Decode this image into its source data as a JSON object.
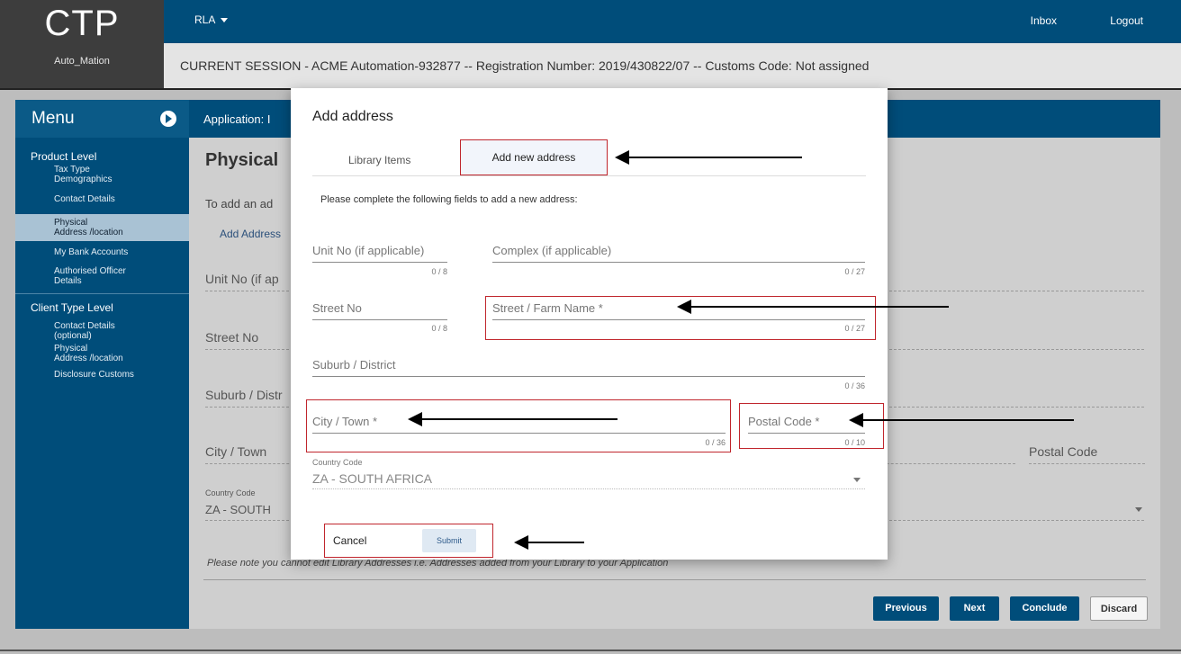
{
  "brand": {
    "logo": "CTP",
    "user": "Auto_Mation"
  },
  "topbar": {
    "menu_label": "RLA",
    "inbox": "Inbox",
    "logout": "Logout"
  },
  "session_text": "CURRENT SESSION - ACME Automation-932877 -- Registration Number: 2019/430822/07 -- Customs Code: Not assigned",
  "menu": {
    "title": "Menu",
    "product_level": "Product Level",
    "product_items": [
      {
        "l1": "Tax Type",
        "l2": "Demographics"
      },
      {
        "l1": "Contact Details",
        "l2": ""
      },
      {
        "l1": "Physical",
        "l2": "Address /location"
      },
      {
        "l1": "My Bank Accounts",
        "l2": ""
      },
      {
        "l1": "Authorised Officer",
        "l2": "Details"
      }
    ],
    "client_level": "Client Type Level",
    "client_items": [
      {
        "l1": "Contact Details",
        "l2": "(optional)"
      },
      {
        "l1": "Physical",
        "l2": "Address /location"
      },
      {
        "l1": "Disclosure Customs",
        "l2": ""
      }
    ]
  },
  "bg": {
    "app_header": "Application: I",
    "page_title": "Physical",
    "to_add": "To add an ad",
    "add_link": "Add Address",
    "unit": "Unit No (if ap",
    "street": "Street No",
    "suburb": "Suburb / Distr",
    "city": "City / Town",
    "postal": "Postal Code",
    "country_label": "Country Code",
    "country_value": "ZA - SOUTH",
    "note": "Please note  you cannot edit Library Addresses i.e. Addresses added from your Library to your Application",
    "buttons": {
      "previous": "Previous",
      "next": "Next",
      "conclude": "Conclude",
      "discard": "Discard"
    }
  },
  "modal": {
    "title": "Add address",
    "tab_library": "Library Items",
    "tab_new": "Add new address",
    "instruction": "Please complete the following fields to add a new address:",
    "unit_no": {
      "label": "Unit No (if applicable)",
      "counter": "0 / 8"
    },
    "complex": {
      "label": "Complex (if applicable)",
      "counter": "0 / 27"
    },
    "street_no": {
      "label": "Street No",
      "counter": "0 / 8"
    },
    "street_name": {
      "label": "Street / Farm Name *",
      "counter": "0 / 27"
    },
    "suburb": {
      "label": "Suburb / District",
      "counter": "0 / 36"
    },
    "city": {
      "label": "City / Town *",
      "counter": "0 / 36"
    },
    "postal": {
      "label": "Postal Code *",
      "counter": "0 / 10"
    },
    "country_label": "Country Code",
    "country_value": "ZA - SOUTH AFRICA",
    "cancel": "Cancel",
    "submit": "Submit"
  }
}
